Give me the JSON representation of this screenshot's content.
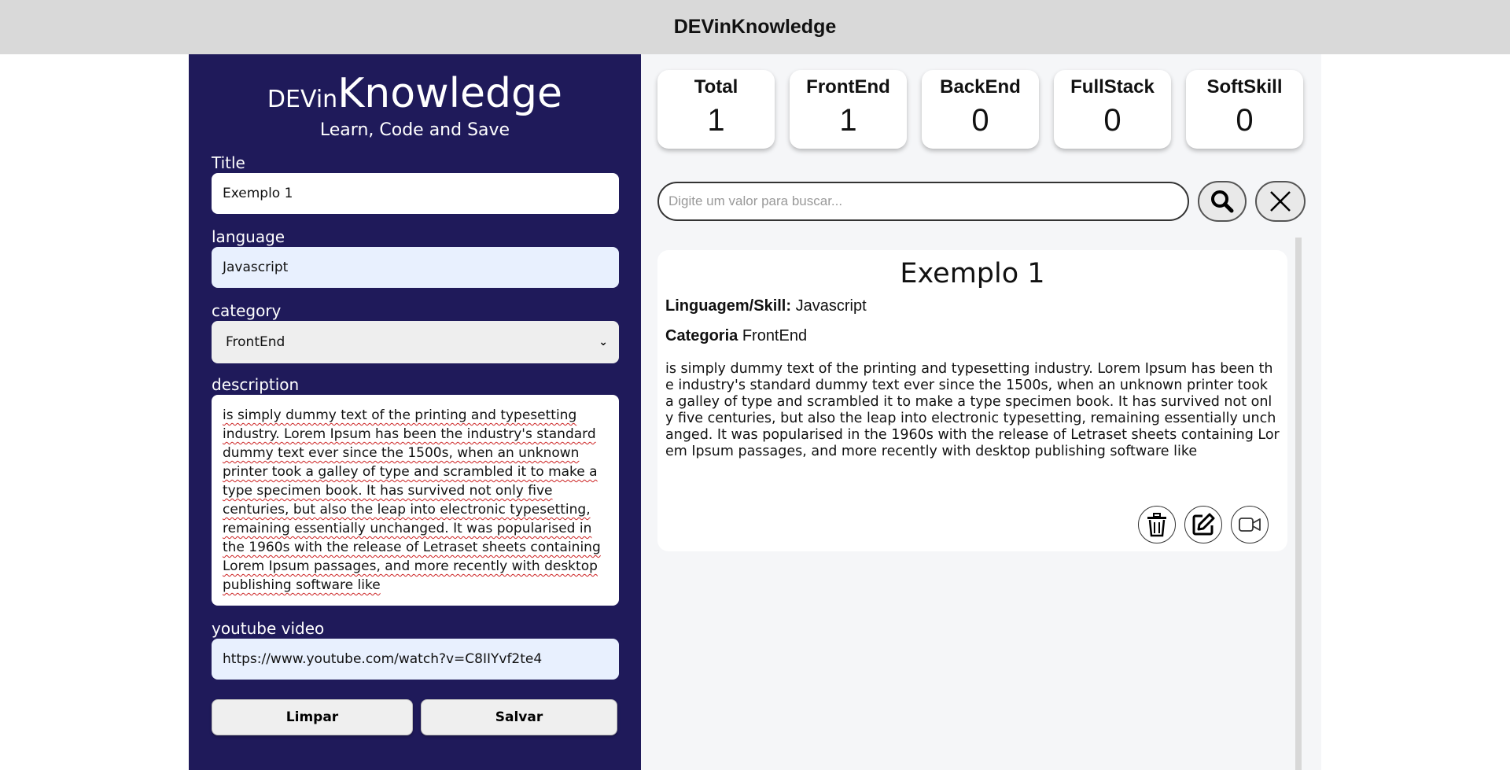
{
  "header": {
    "title": "DEVinKnowledge"
  },
  "brand": {
    "prefix": "DEVin",
    "name": "Knowledge",
    "tagline": "Learn, Code and Save"
  },
  "form": {
    "title_label": "Title",
    "title_value": "Exemplo 1",
    "language_label": "language",
    "language_value": "Javascript",
    "category_label": "category",
    "category_value": "FrontEnd",
    "description_label": "description",
    "description_value": " is simply dummy text of the printing and typesetting industry. Lorem Ipsum has been the industry's standard dummy text ever since the 1500s, when an unknown printer took a galley of type and scrambled it to make a type specimen book. It has survived not only five centuries, but also the leap into electronic typesetting, remaining essentially unchanged. It was popularised in the 1960s with the release of Letraset sheets containing Lorem Ipsum passages, and more recently with desktop publishing software like",
    "youtube_label": "youtube video",
    "youtube_value": "https://www.youtube.com/watch?v=C8IIYvf2te4",
    "clear_label": "Limpar",
    "save_label": "Salvar"
  },
  "stats": [
    {
      "name": "Total",
      "value": "1"
    },
    {
      "name": "FrontEnd",
      "value": "1"
    },
    {
      "name": "BackEnd",
      "value": "0"
    },
    {
      "name": "FullStack",
      "value": "0"
    },
    {
      "name": "SoftSkill",
      "value": "0"
    }
  ],
  "search": {
    "placeholder": "Digite um valor para buscar..."
  },
  "card": {
    "title": "Exemplo 1",
    "language_label": "Linguagem/Skill:",
    "language_value": "Javascript",
    "category_label": "Categoria",
    "category_value": "FrontEnd",
    "description": "is simply dummy text of the printing and typesetting industry. Lorem Ipsum has been the industry's standard dummy text ever since the 1500s, when an unknown printer took a galley of type and scrambled it to make a type specimen book. It has survived not only five centuries, but also the leap into electronic typesetting, remaining essentially unchanged. It was popularised in the 1960s with the release of Letraset sheets containing Lorem Ipsum passages, and more recently with desktop publishing software like"
  },
  "icons": [
    "search-icon",
    "close-icon",
    "trash-icon",
    "edit-icon",
    "video-icon",
    "chevron-down-icon"
  ],
  "colors": {
    "sidebar": "#1f1a5a",
    "topbar": "#d9d9d9",
    "main_bg": "#f5f6f8",
    "autofill": "#e8f0fe"
  }
}
